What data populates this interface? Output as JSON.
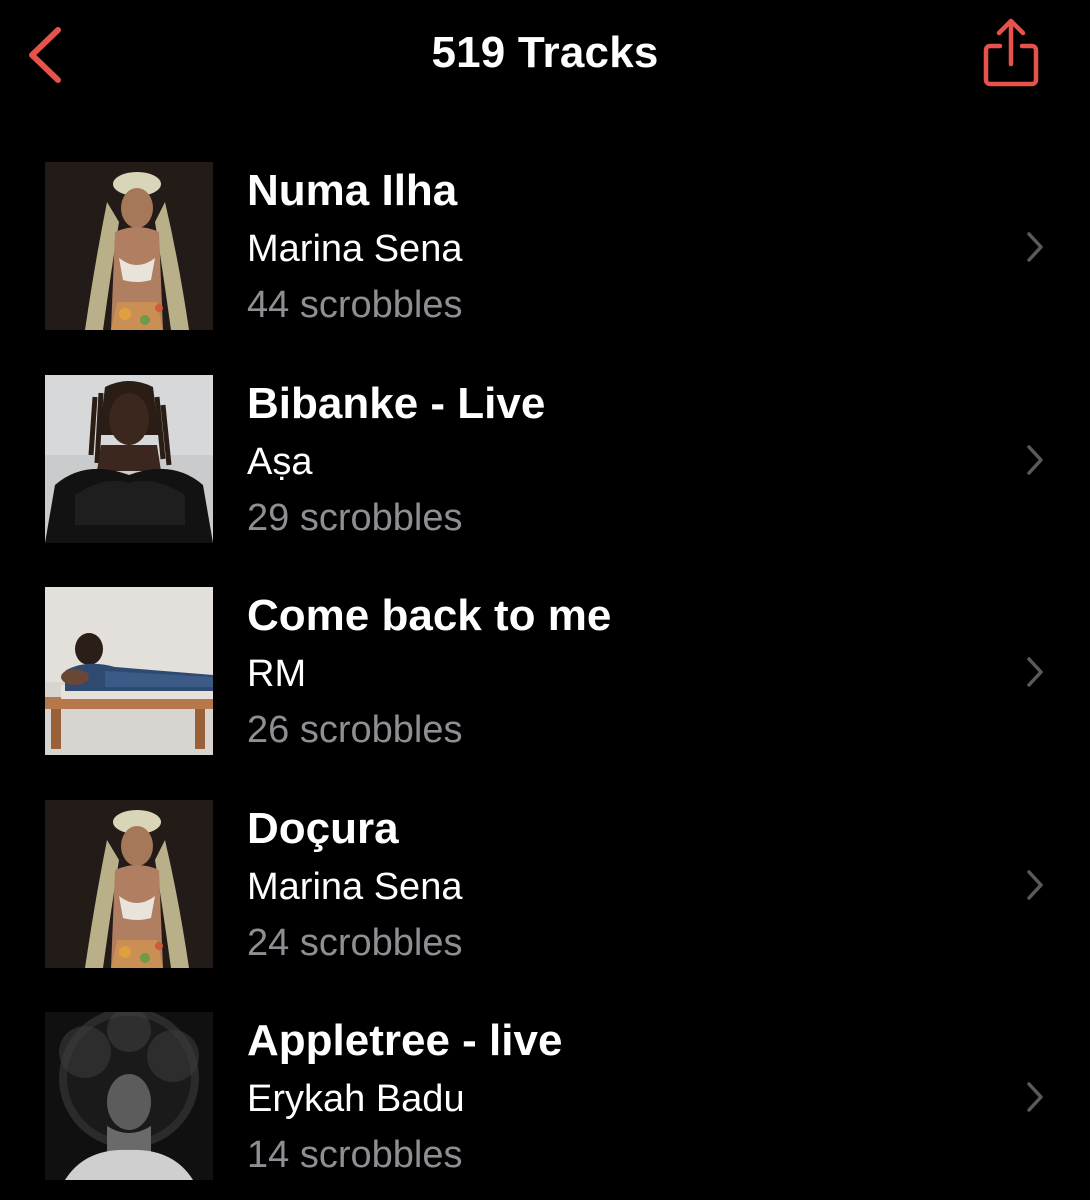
{
  "nav": {
    "title": "519 Tracks",
    "back_icon": "chevron-left-icon",
    "share_icon": "share-icon",
    "accent_color": "#e5534b"
  },
  "tracks": [
    {
      "title": "Numa Ilha",
      "artist": "Marina Sena",
      "scrobbles": "44 scrobbles"
    },
    {
      "title": "Bibanke - Live",
      "artist": "Aṣa",
      "scrobbles": "29 scrobbles"
    },
    {
      "title": "Come back to me",
      "artist": "RM",
      "scrobbles": "26 scrobbles"
    },
    {
      "title": "Doçura",
      "artist": "Marina Sena",
      "scrobbles": "24 scrobbles"
    },
    {
      "title": "Appletree - live",
      "artist": "Erykah Badu",
      "scrobbles": "14 scrobbles"
    }
  ],
  "colors": {
    "background": "#000000",
    "primary_text": "#ffffff",
    "secondary_text": "#8e8e93",
    "chevron": "#5a5a5e"
  }
}
